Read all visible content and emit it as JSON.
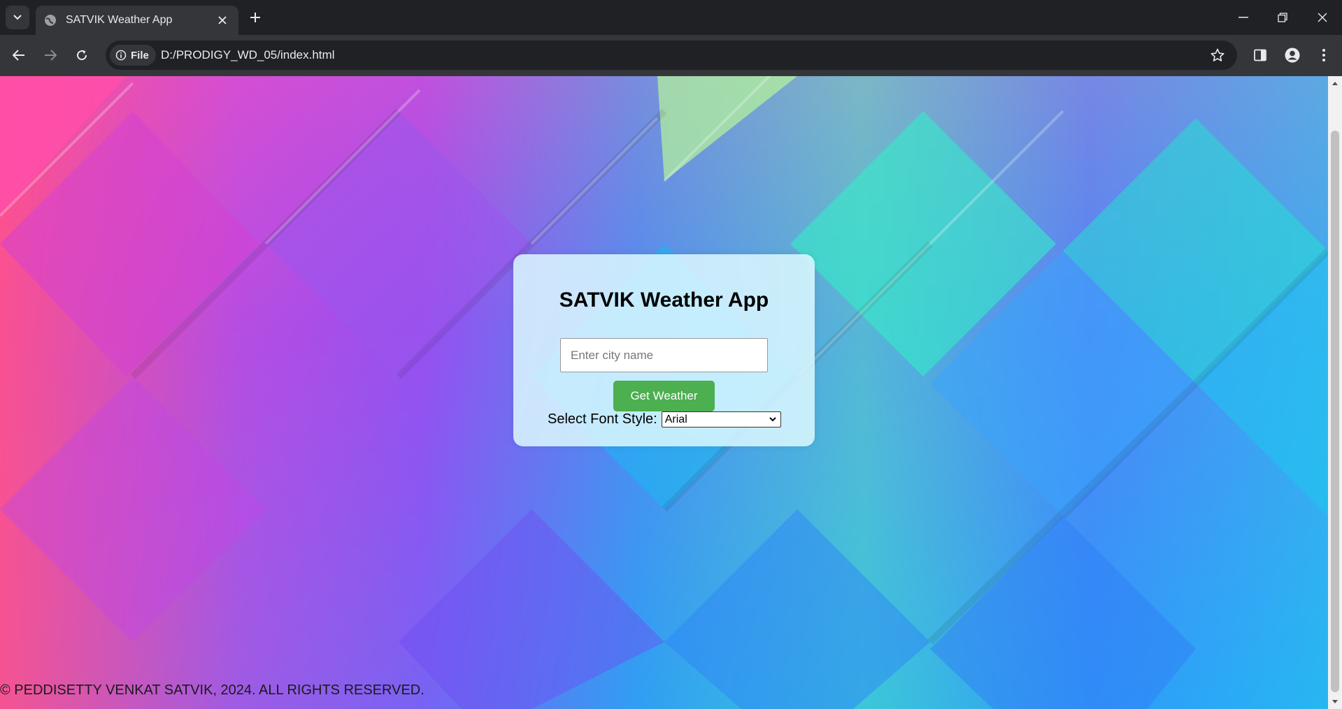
{
  "browser": {
    "tab_title": "SATVIK Weather App",
    "chip_label": "File",
    "url": "D:/PRODIGY_WD_05/index.html"
  },
  "page": {
    "heading": "SATVIK Weather App",
    "city_placeholder": "Enter city name",
    "city_value": "",
    "button_label": "Get Weather",
    "font_label": "Select Font Style:",
    "font_selected": "Arial",
    "footer": "© PEDDISETTY VENKAT SATVIK, 2024. ALL RIGHTS RESERVED."
  },
  "colors": {
    "button": "#4caf50",
    "card": "#dcf8ff",
    "chrome_dark": "#202124",
    "chrome_toolbar": "#35363a"
  },
  "icons": [
    "tab-search-icon",
    "globe-icon",
    "close-icon",
    "plus-icon",
    "minimize-icon",
    "restore-icon",
    "back-icon",
    "forward-icon",
    "reload-icon",
    "info-icon",
    "star-icon",
    "side-panel-icon",
    "profile-icon",
    "more-icon",
    "chevron-down-icon"
  ]
}
